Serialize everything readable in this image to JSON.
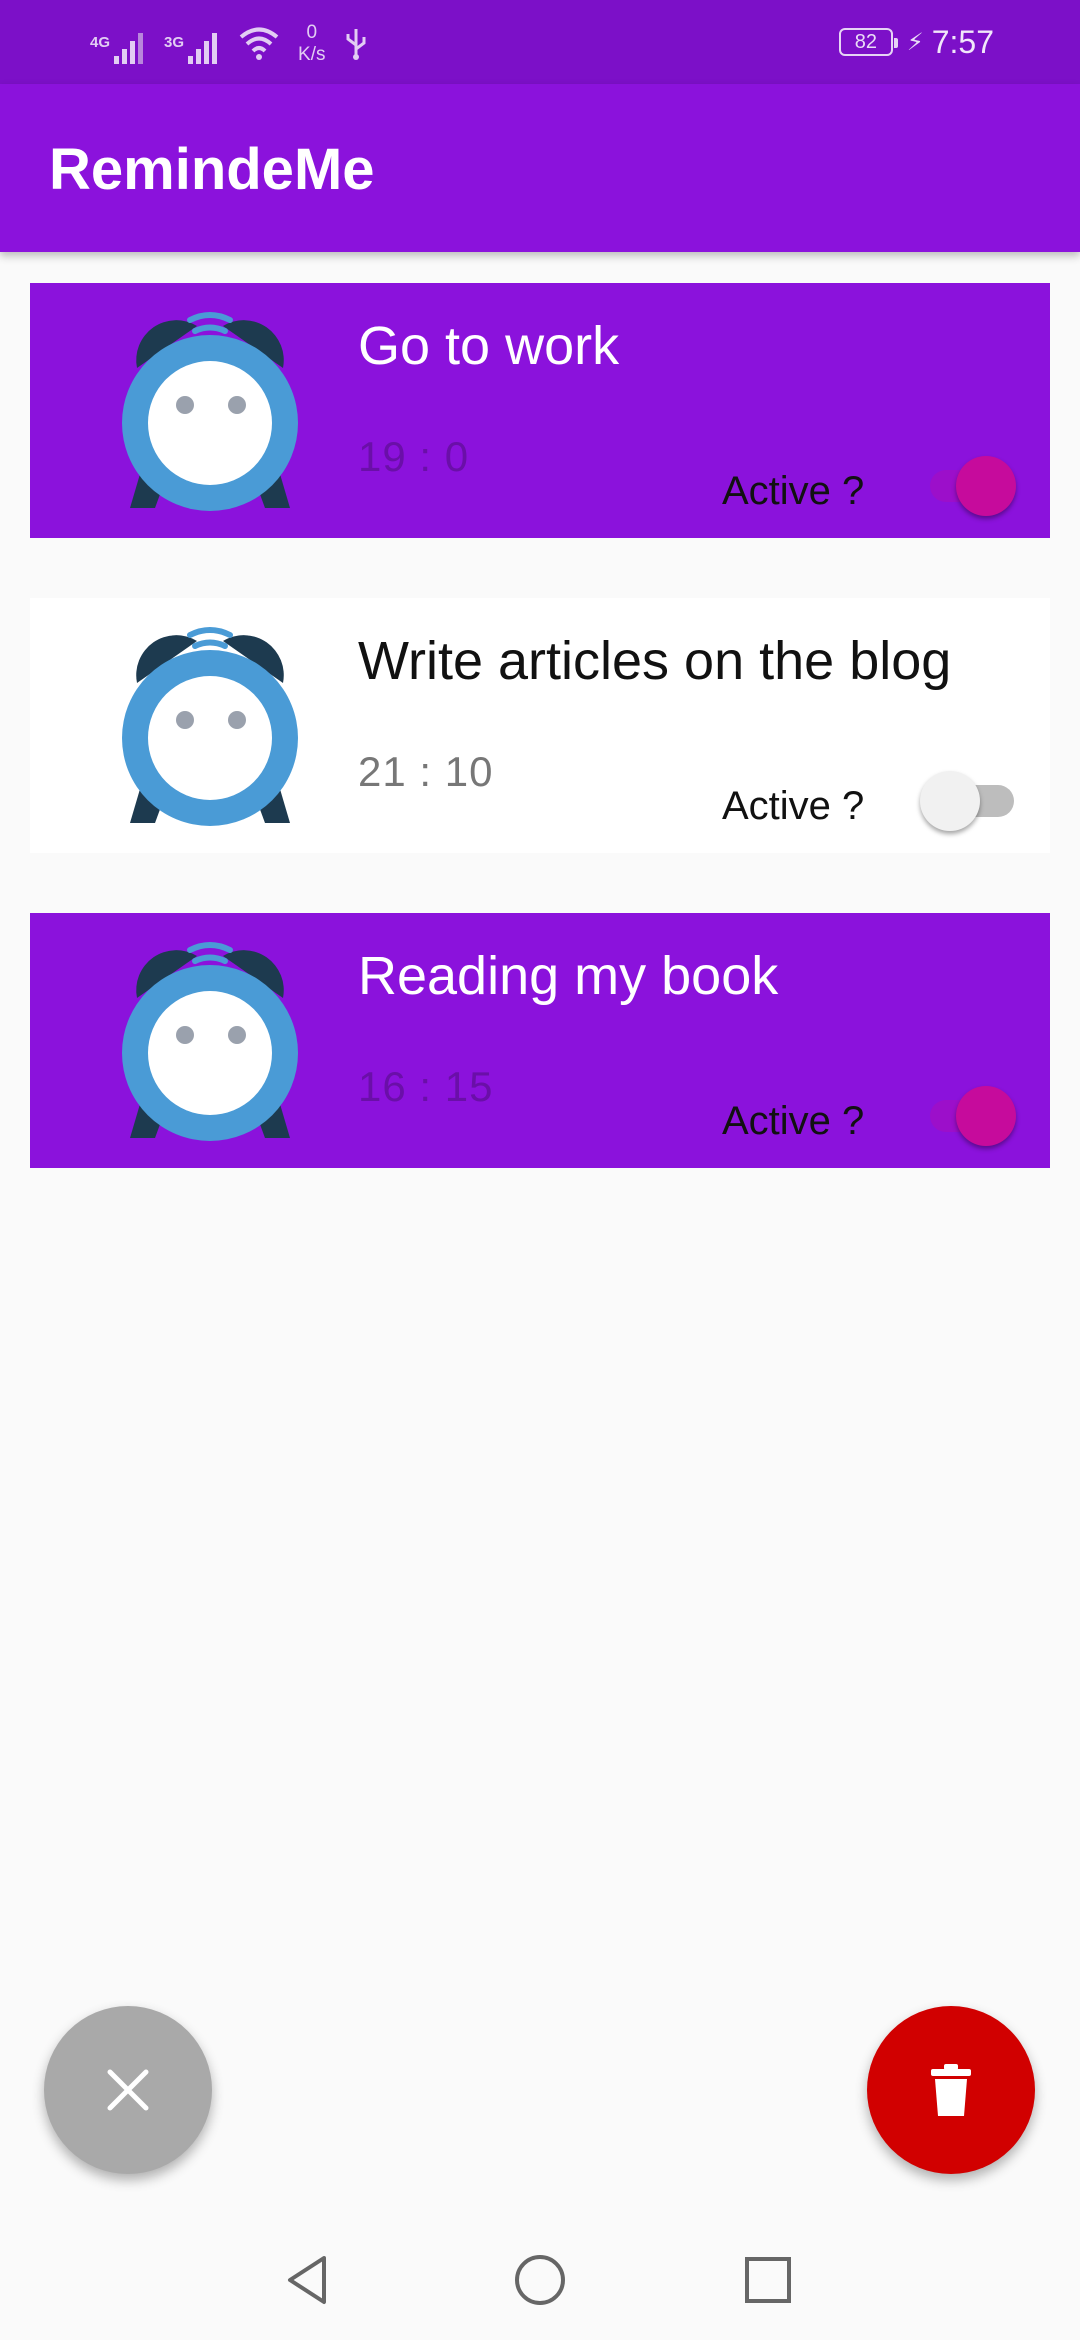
{
  "status_bar": {
    "network_1": "4G",
    "network_2": "3G",
    "speed_value": "0",
    "speed_unit": "K/s",
    "battery": "82",
    "time": "7:57"
  },
  "app_bar": {
    "title": "RemindeMe"
  },
  "reminders": [
    {
      "title": "Go to work",
      "time": "19 : 0",
      "active_label": "Active ?",
      "active": true
    },
    {
      "title": "Write articles on the blog",
      "time": "21 : 10",
      "active_label": "Active ?",
      "active": false
    },
    {
      "title": "Reading my book",
      "time": "16 : 15",
      "active_label": "Active ?",
      "active": true
    }
  ],
  "icons": {
    "reminder": "alarm-clock-icon",
    "close": "close-icon",
    "delete": "trash-icon",
    "back": "back-icon",
    "home": "home-icon",
    "recent": "recent-apps-icon"
  },
  "colors": {
    "status_bar": "#7c10c8",
    "app_bar": "#8b12dc",
    "active_card": "#8b12dc",
    "inactive_card": "#ffffff",
    "switch_on": "#c60b9c",
    "fab_close": "#a9a9a9",
    "fab_delete": "#d10000"
  }
}
